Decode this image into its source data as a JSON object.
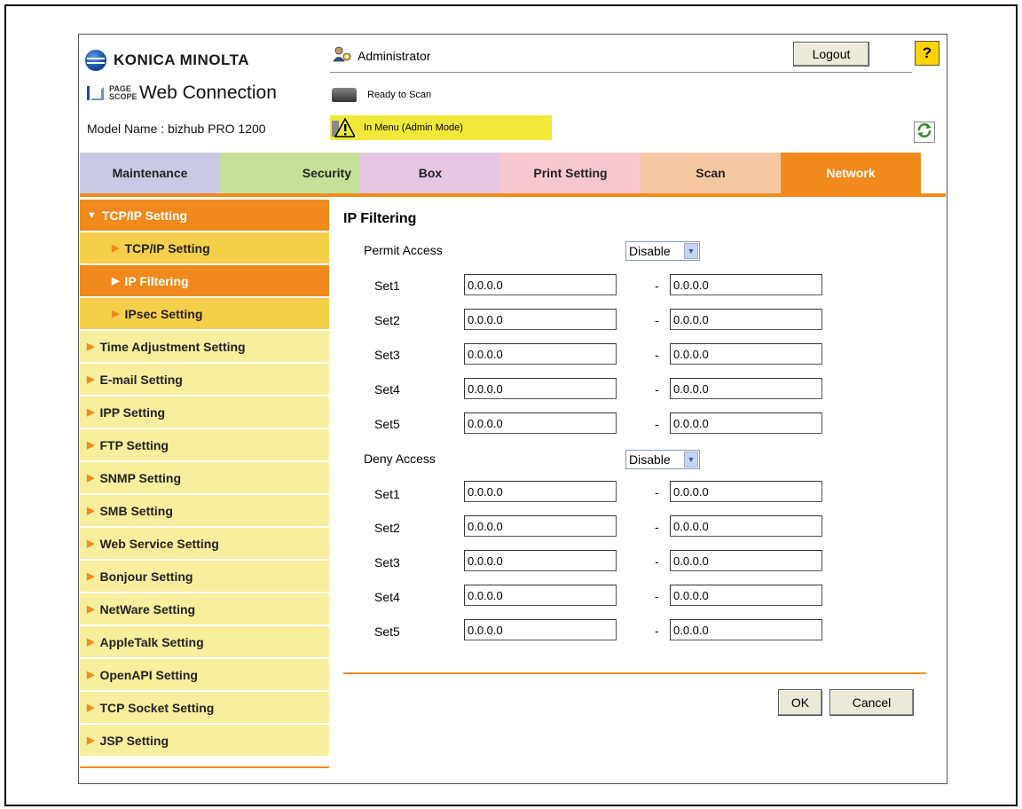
{
  "brand": {
    "name": "KONICA MINOLTA",
    "product_badge": "PAGE SCOPE",
    "product": "Web Connection",
    "model": "Model Name : bizhub PRO 1200"
  },
  "header": {
    "user": "Administrator",
    "logout_label": "Logout",
    "help_label": "?"
  },
  "status": [
    {
      "text": "Ready to Scan",
      "icon": "scanner-icon"
    },
    {
      "text": "In Menu (Admin Mode)",
      "icon": "warning-icon",
      "highlight": "#f2e83a"
    }
  ],
  "tabs": [
    {
      "label": "Maintenance",
      "color": "#c9c9e6"
    },
    {
      "label": "Security",
      "color": "#c6e09a"
    },
    {
      "label": "Box",
      "color": "#e6c6e2"
    },
    {
      "label": "Print Setting",
      "color": "#f6c8ce"
    },
    {
      "label": "Scan",
      "color": "#f6c8a2"
    },
    {
      "label": "Network",
      "color": "#f08a1c",
      "active": true
    }
  ],
  "sidebar": {
    "items": [
      {
        "label": "TCP/IP Setting",
        "level": 0,
        "state": "expanded"
      },
      {
        "label": "TCP/IP Setting",
        "level": 1,
        "state": "sub"
      },
      {
        "label": "IP Filtering",
        "level": 1,
        "state": "active"
      },
      {
        "label": "IPsec Setting",
        "level": 1,
        "state": "sub"
      },
      {
        "label": "Time Adjustment Setting",
        "level": 0
      },
      {
        "label": "E-mail Setting",
        "level": 0
      },
      {
        "label": "IPP Setting",
        "level": 0
      },
      {
        "label": "FTP Setting",
        "level": 0
      },
      {
        "label": "SNMP Setting",
        "level": 0
      },
      {
        "label": "SMB Setting",
        "level": 0
      },
      {
        "label": "Web Service Setting",
        "level": 0
      },
      {
        "label": "Bonjour Setting",
        "level": 0
      },
      {
        "label": "NetWare Setting",
        "level": 0
      },
      {
        "label": "AppleTalk Setting",
        "level": 0
      },
      {
        "label": "OpenAPI Setting",
        "level": 0
      },
      {
        "label": "TCP Socket Setting",
        "level": 0
      },
      {
        "label": "JSP Setting",
        "level": 0
      }
    ]
  },
  "main": {
    "title": "IP Filtering",
    "separator": "-",
    "permit": {
      "label": "Permit Access",
      "select_value": "Disable",
      "sets": [
        {
          "label": "Set1",
          "from": "0.0.0.0",
          "to": "0.0.0.0"
        },
        {
          "label": "Set2",
          "from": "0.0.0.0",
          "to": "0.0.0.0"
        },
        {
          "label": "Set3",
          "from": "0.0.0.0",
          "to": "0.0.0.0"
        },
        {
          "label": "Set4",
          "from": "0.0.0.0",
          "to": "0.0.0.0"
        },
        {
          "label": "Set5",
          "from": "0.0.0.0",
          "to": "0.0.0.0"
        }
      ]
    },
    "deny": {
      "label": "Deny Access",
      "select_value": "Disable",
      "sets": [
        {
          "label": "Set1",
          "from": "0.0.0.0",
          "to": "0.0.0.0"
        },
        {
          "label": "Set2",
          "from": "0.0.0.0",
          "to": "0.0.0.0"
        },
        {
          "label": "Set3",
          "from": "0.0.0.0",
          "to": "0.0.0.0"
        },
        {
          "label": "Set4",
          "from": "0.0.0.0",
          "to": "0.0.0.0"
        },
        {
          "label": "Set5",
          "from": "0.0.0.0",
          "to": "0.0.0.0"
        }
      ]
    },
    "ok_label": "OK",
    "cancel_label": "Cancel"
  },
  "colors": {
    "accent": "#f08a1c",
    "sidebar_light": "#f7ee9e",
    "sidebar_sub": "#f6cf4a"
  }
}
